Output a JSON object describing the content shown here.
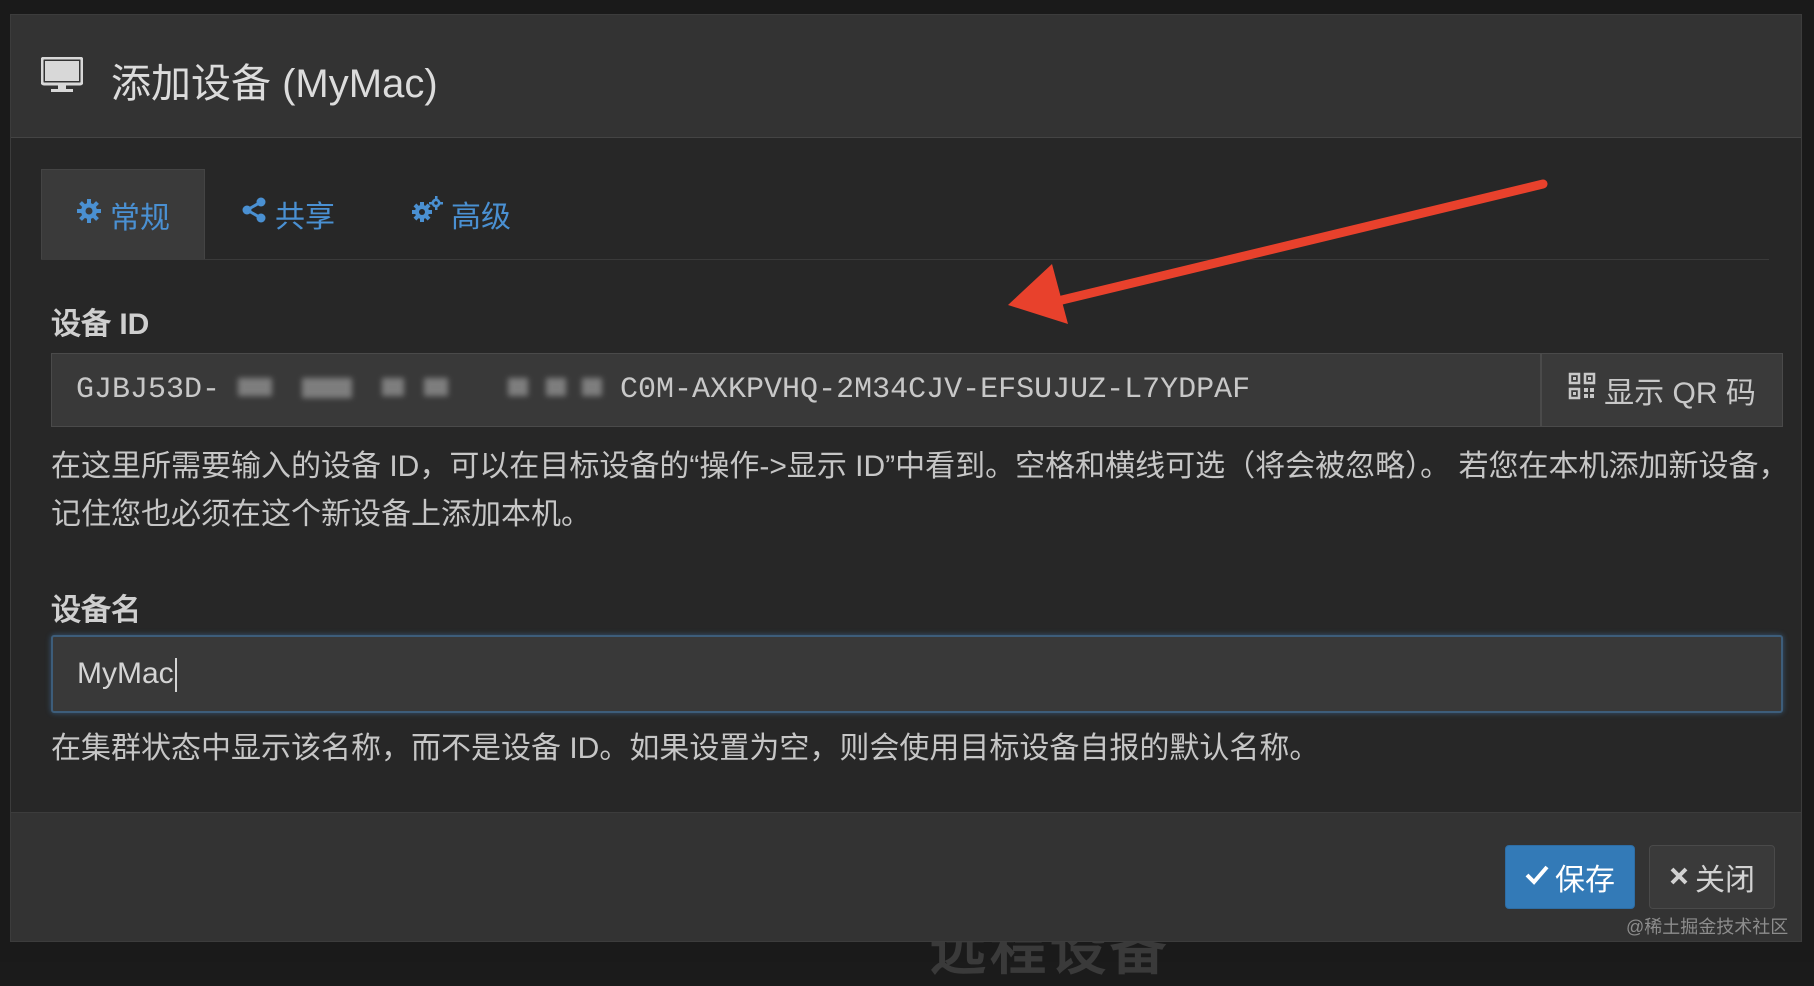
{
  "background": {
    "heading_text": "远程设备"
  },
  "dialog": {
    "title": "添加设备 (MyMac)",
    "icon": "monitor-icon",
    "tabs": [
      {
        "label": "常规",
        "icon": "gear-icon",
        "active": true
      },
      {
        "label": "共享",
        "icon": "share-icon",
        "active": false
      },
      {
        "label": "高级",
        "icon": "gears-icon",
        "active": false
      }
    ],
    "device_id": {
      "label": "设备 ID",
      "value_visible_start": "GJBJ53D-",
      "value_visible_end": "C0M-AXKPVHQ-2M34CJV-EFSUJUZ-L7YDPAF",
      "qr_button_label": "显示 QR 码",
      "qr_icon": "qrcode-icon",
      "help": "在这里所需要输入的设备 ID，可以在目标设备的“操作->显示 ID”中看到。空格和横线可选（将会被忽略）。 若您在本机添加新设备，记住您也必须在这个新设备上添加本机。"
    },
    "device_name": {
      "label": "设备名",
      "value": "MyMac",
      "help": "在集群状态中显示该名称，而不是设备 ID。如果设置为空，则会使用目标设备自报的默认名称。"
    },
    "footer": {
      "save_label": "保存",
      "close_label": "关闭"
    }
  },
  "annotation": {
    "arrow_color": "#e8412c"
  },
  "colors": {
    "accent": "#4a90d2",
    "primary_button": "#337ab7",
    "dialog_bg": "#272727",
    "header_bg": "#333333"
  },
  "watermark": "@稀土掘金技术社区"
}
